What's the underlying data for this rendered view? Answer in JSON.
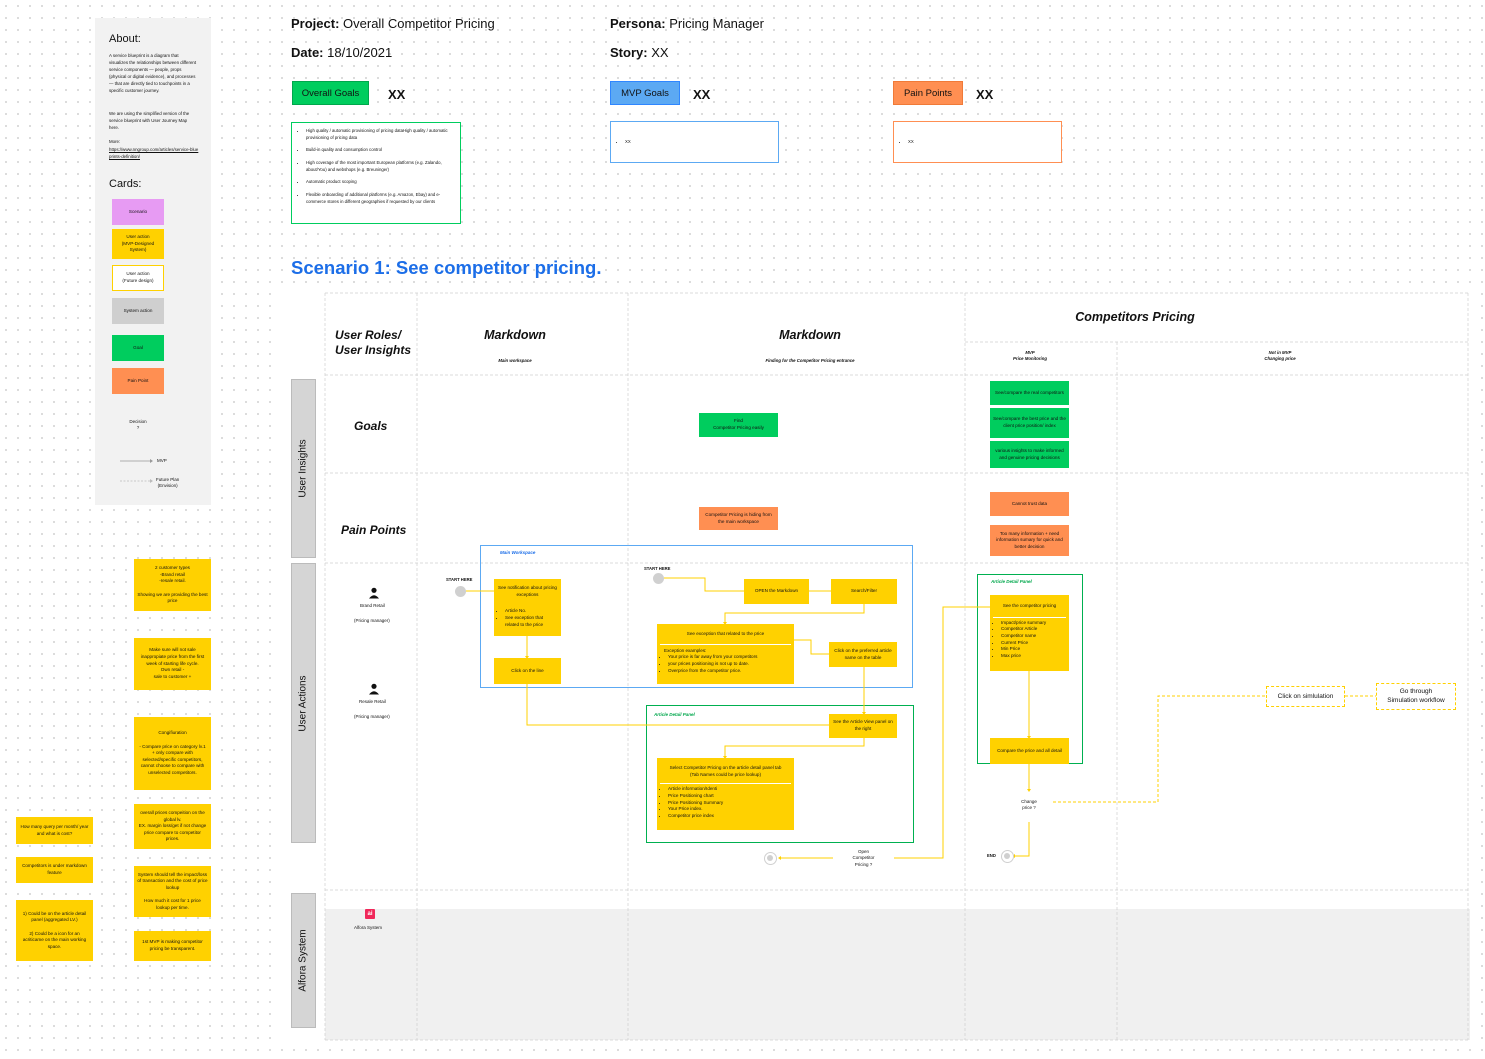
{
  "about": {
    "title": "About:",
    "text": "A service blueprint is a diagram that visualizes the relationships between different service components — people, props (physical or digital evidence), and processes — that are directly tied to touchpoints in a specific customer journey.",
    "text2": "We are using the simplified version of the service blueprint with User Journey Map here.",
    "more": "More:",
    "link": "https://www.nngroup.com/articles/service-blueprints-definition/"
  },
  "legend": {
    "title": "Cards:",
    "scenario": "Scenario",
    "user_action_mvp": "User action\n(MVP-Designed\nSystem)",
    "user_action_future": "User action\n(Future design)",
    "system_action": "System action",
    "goal": "Goal",
    "pain_point": "Pain Point",
    "decision": "Decision\n?",
    "mvp": "MVP",
    "future": "Future Plan\n(Envision)"
  },
  "header": {
    "project_label": "Project:",
    "project_value": "Overall Competitor Pricing",
    "date_label": "Date:",
    "date_value": "18/10/2021",
    "persona_label": "Persona:",
    "persona_value": "Pricing Manager",
    "story_label": "Story:",
    "story_value": "XX"
  },
  "tags": {
    "overall_goals": "Overall Goals",
    "mvp_goals": "MVP Goals",
    "pain_points": "Pain Points",
    "xx": "XX"
  },
  "overall_goals_list": [
    "High quality / automatic provisioning of pricing dataHigh quality / automatic provisioning of pricing data",
    "Build-in quality and consumption control",
    "High coverage of the most important European platforms (e.g. Zalando, about/You) and webshops (e.g. Breuninger)",
    "Automatic product scoping",
    "Flexible onboarding of additional platforms (e.g. Amazon, Ebay) and e-commerce stores in different geographies if requested by our clients"
  ],
  "mvp_list": [
    "XX"
  ],
  "pain_list": [
    "XX"
  ],
  "scenario_title": "Scenario 1: See competitor pricing.",
  "columns": {
    "roles": "User Roles/\nUser Insights",
    "markdown1": "Markdown",
    "markdown1_sub": "Main workspace",
    "markdown2": "Markdown",
    "markdown2_sub": "Finding for the Competitor Pricing entrance",
    "competitors": "Competitors Pricing",
    "mvp_sub": "MVP\nPrice Monitoring",
    "notmvp_sub": "Not in MVP\nChanging price"
  },
  "sections": {
    "user_insights": "User Insights",
    "user_actions": "User Actions",
    "system": "Alfora System"
  },
  "rows": {
    "goals": "Goals",
    "pain_points": "Pain Points"
  },
  "roles": {
    "brand": "Brand Retail",
    "brand_sub": "(Pricing manager)",
    "resale": "Resale Retail",
    "resale_sub": "(Pricing manager)",
    "system": "Alfora System",
    "system_logo": "ai"
  },
  "goals_cards": {
    "find": "Find\nCompetitor Pricing easily",
    "g1": "See/compare the real competitors",
    "g2": "See/compare the best price and the client price position/ index",
    "g3": "various insights to make informed and genuine pricing decisions"
  },
  "pain_cards": {
    "hiding": "Competitor Pricing is hiding from the main workspace",
    "trust": "Cannot trust data",
    "toomuch": "Too many information + need information sumary for quick and better decision"
  },
  "flow": {
    "start": "START HERE",
    "main_ws": "Main Workspace",
    "notif": "See notification about pricing exceptions",
    "notif_b": [
      "Article No.",
      "See exception that related to the price"
    ],
    "click_line": "Click on the line",
    "open_md": "OPEN the Markdown",
    "search": "Search/Filter",
    "exception": "See exception that related to the price",
    "exception_sub": "Exception examples:",
    "exception_b": [
      "Your price is far away from your competitors",
      "your prices positioning is not up to date.",
      "Overprice from the competitor price."
    ],
    "click_pref": "Click on the preferred article name on the table",
    "adp": "Article Detail Panel",
    "see_view": "See the Article View panel on the right",
    "select": "Select Competitor Pricing on the article detail panel tab\n(Tab Names could be price lookup)",
    "select_b": [
      "Article information/Identi",
      "Price Positioning chart",
      "Price Positioning Summary",
      "Your Price index.",
      "Competitor price index"
    ],
    "open_cp": "Open\nCompetitor\nPricing ?",
    "adp2": "Article Detail Panel",
    "see_cp": "See the competitor pricing",
    "see_cp_b": [
      "Impact/price summary",
      "Competitor Article",
      "Competitor name",
      "Current Price",
      "Min Price",
      "Max price"
    ],
    "compare": "Compare the price and all detail",
    "change": "Change\nprice ?",
    "end": "END",
    "click_sim": "Click on simlulation",
    "go_sim": "Go through\nSimulation workflow"
  },
  "notes_right": [
    "2 customer types\n-Brand retail\n-resale retail.\n\nShowing we are providing the best price",
    "Make sure will not sale inappropiate price from the first week of starting life cycle.\nOwn retail -\nsale to customer +",
    "Congifiuration\n\n- Compare price on category lv.1\n+ only compare with selected/specific competitors, cannot choose to compare with unselected competitors.",
    "overall prices compeition on the global lv.\nEX. margin loss/get if not change price compare to competitor prices.",
    "System should tell the impact/loss of transaction and the cost of price lookup\n\nHow much it cost for 1 price lookup per time.",
    "1st MVP is making competitor pricing be transparent."
  ],
  "notes_left": [
    "How many query per month/ year and what is cost?",
    "Competitors is under markdown feature",
    "1) Could be on the article detail panel (aggregated LV.)\n\n2) Could be a icon for an acriticame on the main working space."
  ],
  "colors": {
    "yellow": "#ffd100",
    "green": "#00cd5e",
    "orange": "#ff8f52",
    "blue": "#2f86ff",
    "purple": "#e79bf3",
    "grey": "#cfcfcf",
    "scenario_blue": "#1c6ee8"
  }
}
